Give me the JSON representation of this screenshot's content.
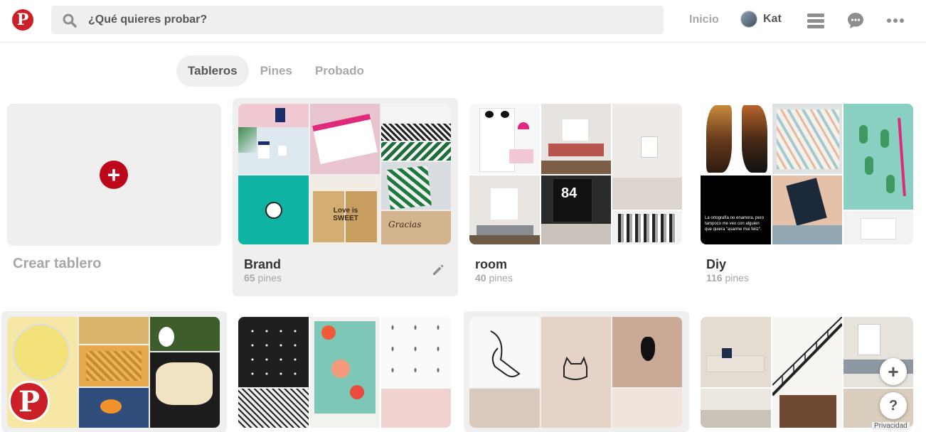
{
  "header": {
    "logo": "P",
    "search_placeholder": "¿Qué quieres probar?",
    "home": "Inicio",
    "user_name": "Kat"
  },
  "tabs": [
    {
      "label": "Tableros",
      "active": true
    },
    {
      "label": "Pines",
      "active": false
    },
    {
      "label": "Probado",
      "active": false
    }
  ],
  "create_board": {
    "label": "Crear tablero"
  },
  "boards": [
    {
      "title": "Brand",
      "count": "65",
      "unit": "pines"
    },
    {
      "title": "room",
      "count": "40",
      "unit": "pines"
    },
    {
      "title": "Diy",
      "count": "116",
      "unit": "pines"
    }
  ],
  "thumb_texts": {
    "brand_bag": "Love is SWEET",
    "brand_card": "Gracias",
    "diy_book": "La ortografía no enamora, pero tampoco me veo con alguien que quiera \"asarme mui feliz\".",
    "room_shirt": "84"
  },
  "fab": {
    "add": "+",
    "help": "?"
  },
  "footer": {
    "privacy": "Privacidad"
  }
}
